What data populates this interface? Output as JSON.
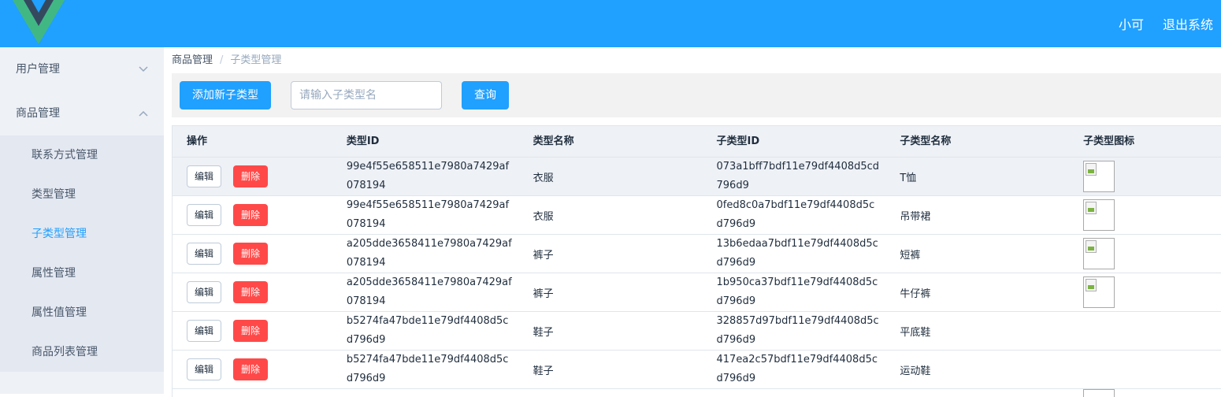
{
  "header": {
    "logo": "vue-logo-icon",
    "user_name": "小可",
    "logout_label": "退出系统",
    "bg_color": "#20a0ff"
  },
  "sidebar": {
    "menus": [
      {
        "label": "用户管理",
        "expanded": false,
        "icon": "chevron-down-icon"
      },
      {
        "label": "商品管理",
        "expanded": true,
        "icon": "chevron-up-icon"
      }
    ],
    "submenu": [
      "联系方式管理",
      "类型管理",
      "子类型管理",
      "属性管理",
      "属性值管理",
      "商品列表管理"
    ],
    "active_item": "子类型管理"
  },
  "breadcrumb": {
    "level1": "商品管理",
    "separator": "/",
    "level2": "子类型管理"
  },
  "toolbar": {
    "add_label": "添加新子类型",
    "search_placeholder": "请输入子类型名",
    "search_value": "",
    "query_label": "查询"
  },
  "table": {
    "headers": [
      "操作",
      "类型ID",
      "类型名称",
      "子类型ID",
      "子类型名称",
      "子类型图标"
    ],
    "edit_label": "编辑",
    "delete_label": "删除",
    "rows": [
      {
        "type_id": "99e4f55e658511e7980a7429af078194",
        "type_name": "衣服",
        "subtype_id": "073a1bff7bdf11e79df4408d5cd796d9",
        "subtype_name": "T恤",
        "icon": "broken-image-icon"
      },
      {
        "type_id": "99e4f55e658511e7980a7429af078194",
        "type_name": "衣服",
        "subtype_id": "0fed8c0a7bdf11e79df4408d5cd796d9",
        "subtype_name": "吊带裙",
        "icon": "broken-image-icon"
      },
      {
        "type_id": "a205dde3658411e7980a7429af078194",
        "type_name": "裤子",
        "subtype_id": "13b6edaa7bdf11e79df4408d5cd796d9",
        "subtype_name": "短裤",
        "icon": "broken-image-icon"
      },
      {
        "type_id": "a205dde3658411e7980a7429af078194",
        "type_name": "裤子",
        "subtype_id": "1b950ca37bdf11e79df4408d5cd796d9",
        "subtype_name": "牛仔裤",
        "icon": "broken-image-icon"
      },
      {
        "type_id": "b5274fa47bde11e79df4408d5cd796d9",
        "type_name": "鞋子",
        "subtype_id": "328857d97bdf11e79df4408d5cd796d9",
        "subtype_name": "平底鞋",
        "icon": ""
      },
      {
        "type_id": "b5274fa47bde11e79df4408d5cd796d9",
        "type_name": "鞋子",
        "subtype_id": "417ea2c57bdf11e79df4408d5cd796d9",
        "subtype_name": "运动鞋",
        "icon": ""
      }
    ]
  }
}
